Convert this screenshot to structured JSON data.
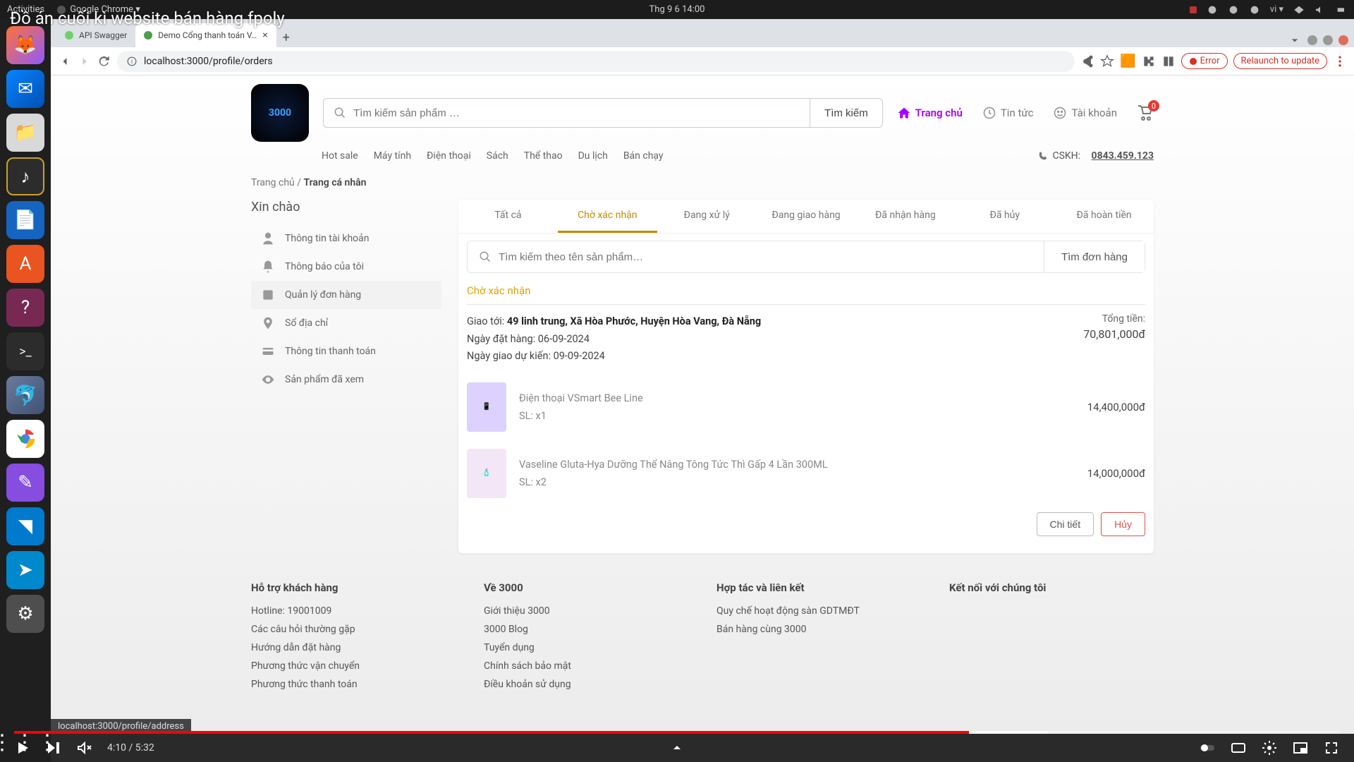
{
  "ubuntu": {
    "activities": "Activities",
    "chrome": "Google Chrome ▾",
    "datetime": "Thg 9 6  14:00",
    "lang": "vi ▾"
  },
  "video": {
    "title": "Đồ án cuối kì website bán hàng fpoly"
  },
  "tabs": {
    "first": "API Swagger",
    "second": "Demo Cổng thanh toán V…"
  },
  "addr": {
    "url": "localhost:3000/profile/orders",
    "error": "Error",
    "relaunch": "Relaunch to update"
  },
  "header": {
    "search_placeholder": "Tìm kiếm sản phẩm …",
    "search_btn": "Tìm kiếm",
    "nav": {
      "home": "Trang chủ",
      "news": "Tin tức",
      "account": "Tài khoản"
    },
    "cart_count": "0",
    "subnav": [
      "Hot sale",
      "Máy tính",
      "Điện thoại",
      "Sách",
      "Thể thao",
      "Du lịch",
      "Bán chạy"
    ],
    "cskh_label": "CSKH:",
    "cskh_phone": "0843.459.123"
  },
  "breadcrumb": {
    "home": "Trang chủ",
    "sep": "/",
    "current": "Trang cá nhân"
  },
  "sidebar": {
    "greeting": "Xin chào",
    "items": [
      "Thông tin tài khoản",
      "Thông báo của tôi",
      "Quản lý đơn hàng",
      "Sổ địa chỉ",
      "Thông tin thanh toán",
      "Sản phẩm đã xem"
    ]
  },
  "order_tabs": [
    "Tất cả",
    "Chờ xác nhận",
    "Đang xử lý",
    "Đang giao hàng",
    "Đã nhận hàng",
    "Đã hủy",
    "Đã hoàn tiền"
  ],
  "order_search": {
    "placeholder": "Tìm kiếm theo tên sản phẩm…",
    "btn": "Tìm đơn hàng"
  },
  "order": {
    "status": "Chờ xác nhận",
    "ship_label": "Giao tới:",
    "ship_addr": "49 linh trung, Xã Hòa Phước, Huyện Hòa Vang, Đà Nẵng",
    "order_date_lbl": "Ngày đặt hàng:",
    "order_date": "06-09-2024",
    "ship_date_lbl": "Ngày giao dự kiến:",
    "ship_date": "09-09-2024",
    "total_lbl": "Tổng tiền:",
    "total_val": "70,801,000đ",
    "items": [
      {
        "name": "Điện thoại VSmart Bee Line",
        "qty": "SL: x1",
        "price": "14,400,000đ"
      },
      {
        "name": "Vaseline Gluta-Hya Dưỡng Thể Nâng Tông Tức Thì Gấp 4 Lần 300ML",
        "qty": "SL: x2",
        "price": "14,000,000đ"
      }
    ],
    "detail_btn": "Chi tiết",
    "cancel_btn": "Hủy"
  },
  "footer": {
    "col1": {
      "title": "Hỗ trợ khách hàng",
      "links": [
        "Hotline: 19001009",
        "Các câu hỏi thường gặp",
        "Hướng dẫn đặt hàng",
        "Phương thức vận chuyển",
        "Phương thức thanh toán"
      ]
    },
    "col2": {
      "title": "Về 3000",
      "links": [
        "Giới thiệu 3000",
        "3000 Blog",
        "Tuyển dụng",
        "Chính sách bảo mật",
        "Điều khoản sử dụng"
      ]
    },
    "col3": {
      "title": "Hợp tác và liên kết",
      "links": [
        "Quy chế hoạt động sàn GDTMĐT",
        "Bán hàng cùng 3000"
      ]
    },
    "col4": {
      "title": "Kết nối với chúng tôi"
    }
  },
  "player": {
    "current": "4:10",
    "duration": "5:32",
    "sep": " / "
  },
  "status_url": "localhost:3000/profile/address"
}
